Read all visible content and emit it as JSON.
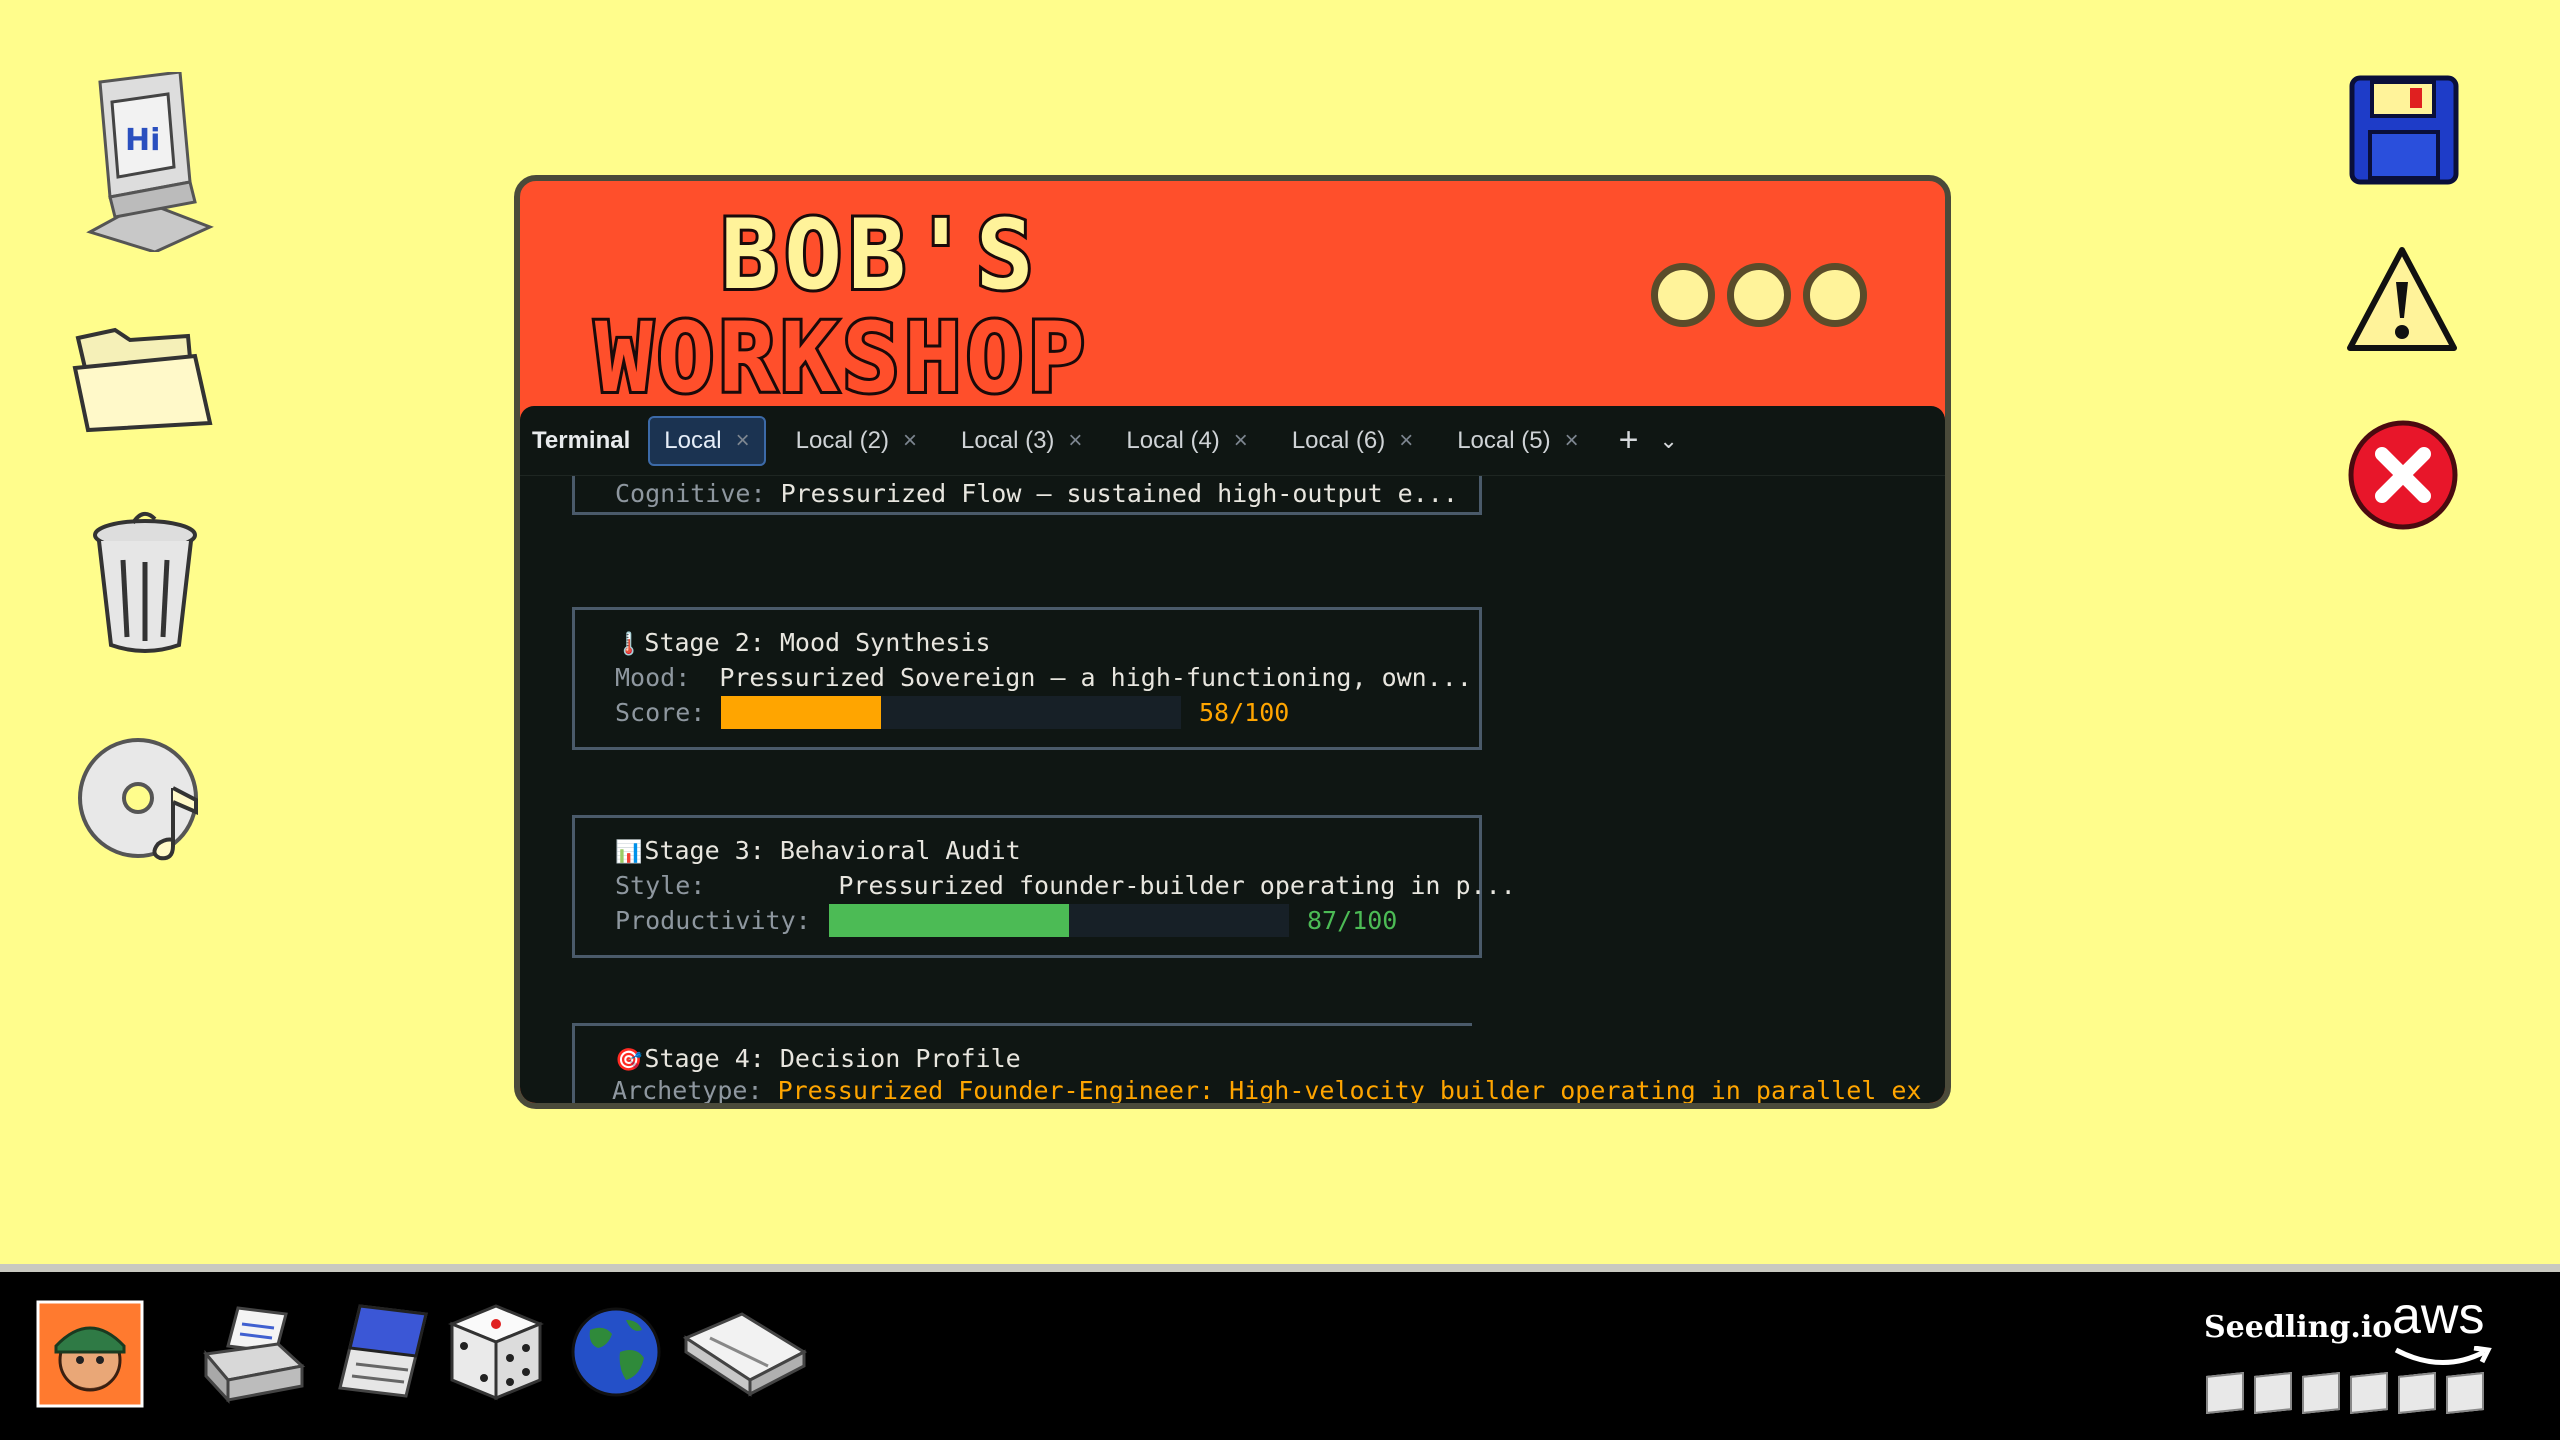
{
  "desktop": {
    "left_icons": [
      "computer-icon",
      "folder-icon",
      "trash-icon",
      "cd-music-icon"
    ],
    "right_icons": [
      "floppy-disk-icon",
      "warning-icon",
      "error-icon"
    ],
    "computer_screen_text": "Hi"
  },
  "window": {
    "title_line1": "BOB'S",
    "title_line2": "WORKSHOP",
    "title_bg_color": "#FF4F2B",
    "title_text_color": "#FFF39A"
  },
  "terminal": {
    "title": "Terminal",
    "tabs": [
      {
        "label": "Local",
        "active": true
      },
      {
        "label": "Local (2)",
        "active": false
      },
      {
        "label": "Local (3)",
        "active": false
      },
      {
        "label": "Local (4)",
        "active": false
      },
      {
        "label": "Local (6)",
        "active": false
      },
      {
        "label": "Local (5)",
        "active": false
      }
    ],
    "close_glyph": "×",
    "add_glyph": "+",
    "more_glyph": "⌄",
    "lines": {
      "cognitive_label": "Cognitive:",
      "cognitive_value": "Pressurized Flow — sustained high-output e...",
      "stage2_icon": "🌡️",
      "stage2_title": "Stage 2: Mood Synthesis",
      "mood_label": "Mood:",
      "mood_value": "Pressurized Sovereign — a high-functioning, own...",
      "score_label": "Score:",
      "score_text": "58/100",
      "score_value": 58,
      "stage3_icon": "📊",
      "stage3_title": "Stage 3: Behavioral Audit",
      "style_label": "Style:",
      "style_value": "Pressurized founder-builder operating in p...",
      "productivity_label": "Productivity:",
      "productivity_text": "87/100",
      "productivity_value": 87,
      "stage4_icon": "🎯",
      "stage4_title": "Stage 4: Decision Profile",
      "archetype_label": "Archetype:",
      "archetype_value": "Pressurized Founder-Engineer: High-velocity builder operating in parallel ex"
    },
    "colors": {
      "score_bar": "#FFA500",
      "productivity_bar": "#4CBB55",
      "score_text": "#FFA500",
      "productivity_text": "#4CBB55",
      "archetype_text": "#FFA500"
    }
  },
  "taskbar": {
    "items": [
      "bob-avatar-icon",
      "printer-icon",
      "notepad-icon",
      "dice-icon",
      "globe-icon",
      "scanner-icon"
    ],
    "brand": "Seedling.io",
    "aws": "aws"
  }
}
